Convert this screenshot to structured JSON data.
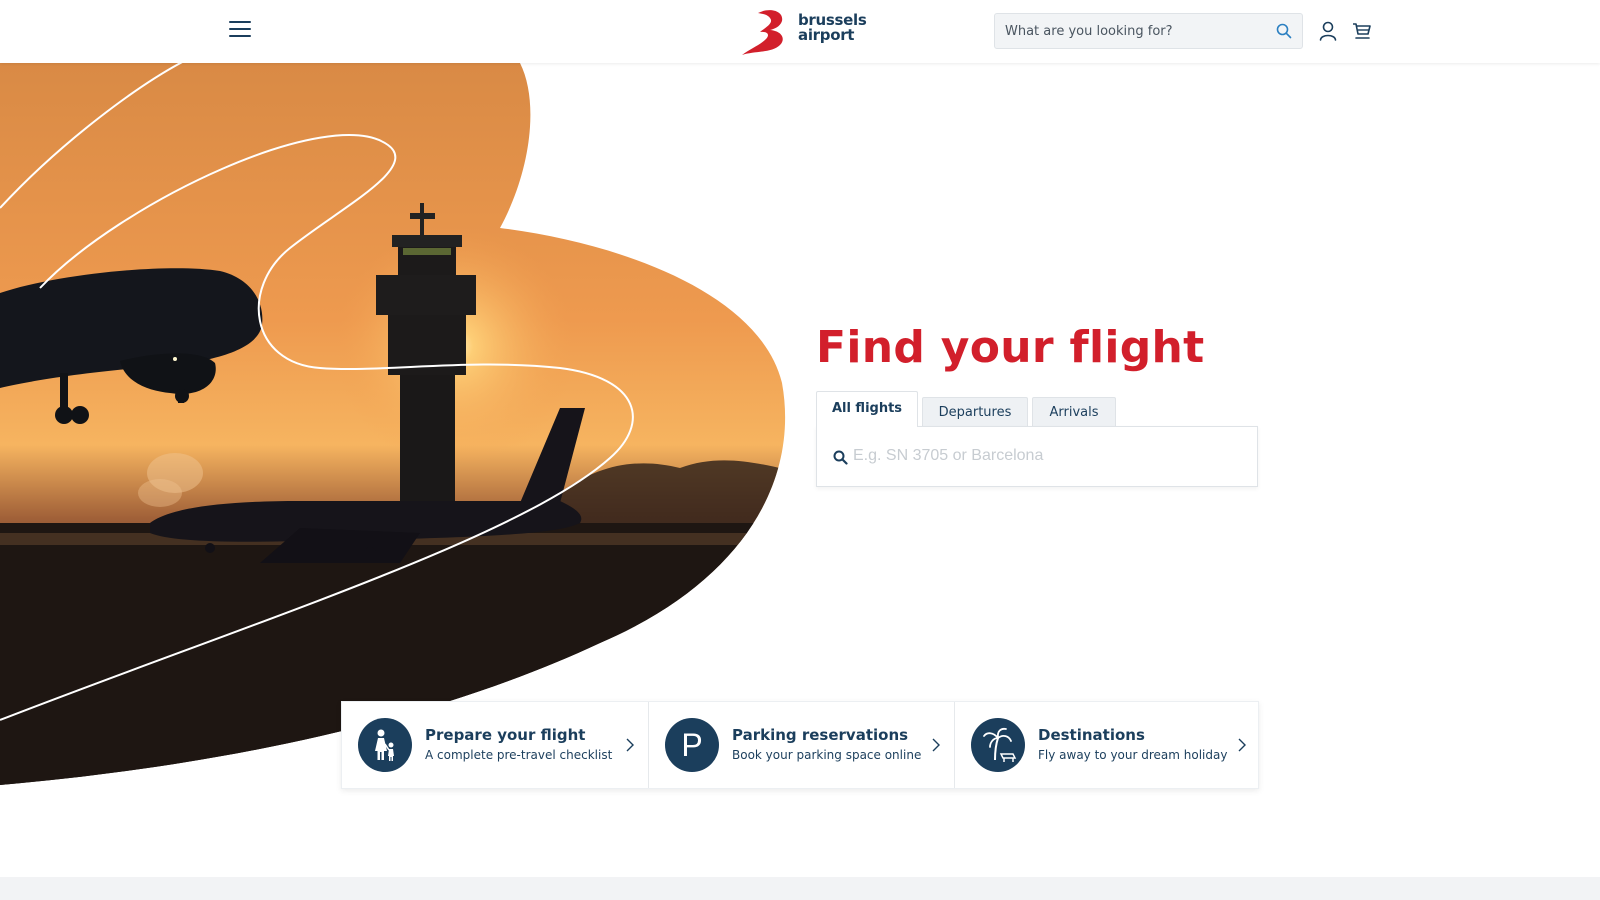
{
  "header": {
    "brand_line1": "brussels",
    "brand_line2": "airport",
    "search_placeholder": "What are you looking for?",
    "icons": [
      "menu-icon",
      "search-icon",
      "user-icon",
      "cart-icon"
    ]
  },
  "hero": {
    "title": "Find your flight",
    "tabs": [
      {
        "label": "All flights",
        "active": true
      },
      {
        "label": "Departures",
        "active": false
      },
      {
        "label": "Arrivals",
        "active": false
      }
    ],
    "flight_search_placeholder": "E.g. SN 3705 or Barcelona"
  },
  "quick_links": [
    {
      "title": "Prepare your flight",
      "subtitle": "A complete pre-travel checklist",
      "icon": "family-icon"
    },
    {
      "title": "Parking reservations",
      "subtitle": "Book your parking space online",
      "icon": "parking-icon",
      "icon_letter": "P"
    },
    {
      "title": "Destinations",
      "subtitle": "Fly away to your dream holiday",
      "icon": "palm-tree-icon"
    }
  ],
  "colors": {
    "brand_red": "#d21f2b",
    "brand_navy": "#1b3e5c",
    "sky_orange": "#f0a050"
  }
}
